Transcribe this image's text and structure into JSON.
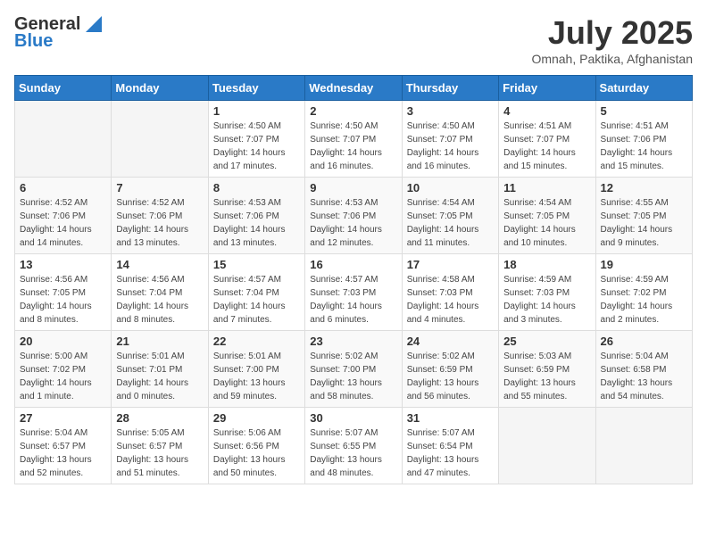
{
  "header": {
    "logo_line1": "General",
    "logo_line2": "Blue",
    "title": "July 2025",
    "subtitle": "Omnah, Paktika, Afghanistan"
  },
  "columns": [
    "Sunday",
    "Monday",
    "Tuesday",
    "Wednesday",
    "Thursday",
    "Friday",
    "Saturday"
  ],
  "weeks": [
    [
      {
        "day": "",
        "info": ""
      },
      {
        "day": "",
        "info": ""
      },
      {
        "day": "1",
        "info": "Sunrise: 4:50 AM\nSunset: 7:07 PM\nDaylight: 14 hours\nand 17 minutes."
      },
      {
        "day": "2",
        "info": "Sunrise: 4:50 AM\nSunset: 7:07 PM\nDaylight: 14 hours\nand 16 minutes."
      },
      {
        "day": "3",
        "info": "Sunrise: 4:50 AM\nSunset: 7:07 PM\nDaylight: 14 hours\nand 16 minutes."
      },
      {
        "day": "4",
        "info": "Sunrise: 4:51 AM\nSunset: 7:07 PM\nDaylight: 14 hours\nand 15 minutes."
      },
      {
        "day": "5",
        "info": "Sunrise: 4:51 AM\nSunset: 7:06 PM\nDaylight: 14 hours\nand 15 minutes."
      }
    ],
    [
      {
        "day": "6",
        "info": "Sunrise: 4:52 AM\nSunset: 7:06 PM\nDaylight: 14 hours\nand 14 minutes."
      },
      {
        "day": "7",
        "info": "Sunrise: 4:52 AM\nSunset: 7:06 PM\nDaylight: 14 hours\nand 13 minutes."
      },
      {
        "day": "8",
        "info": "Sunrise: 4:53 AM\nSunset: 7:06 PM\nDaylight: 14 hours\nand 13 minutes."
      },
      {
        "day": "9",
        "info": "Sunrise: 4:53 AM\nSunset: 7:06 PM\nDaylight: 14 hours\nand 12 minutes."
      },
      {
        "day": "10",
        "info": "Sunrise: 4:54 AM\nSunset: 7:05 PM\nDaylight: 14 hours\nand 11 minutes."
      },
      {
        "day": "11",
        "info": "Sunrise: 4:54 AM\nSunset: 7:05 PM\nDaylight: 14 hours\nand 10 minutes."
      },
      {
        "day": "12",
        "info": "Sunrise: 4:55 AM\nSunset: 7:05 PM\nDaylight: 14 hours\nand 9 minutes."
      }
    ],
    [
      {
        "day": "13",
        "info": "Sunrise: 4:56 AM\nSunset: 7:05 PM\nDaylight: 14 hours\nand 8 minutes."
      },
      {
        "day": "14",
        "info": "Sunrise: 4:56 AM\nSunset: 7:04 PM\nDaylight: 14 hours\nand 8 minutes."
      },
      {
        "day": "15",
        "info": "Sunrise: 4:57 AM\nSunset: 7:04 PM\nDaylight: 14 hours\nand 7 minutes."
      },
      {
        "day": "16",
        "info": "Sunrise: 4:57 AM\nSunset: 7:03 PM\nDaylight: 14 hours\nand 6 minutes."
      },
      {
        "day": "17",
        "info": "Sunrise: 4:58 AM\nSunset: 7:03 PM\nDaylight: 14 hours\nand 4 minutes."
      },
      {
        "day": "18",
        "info": "Sunrise: 4:59 AM\nSunset: 7:03 PM\nDaylight: 14 hours\nand 3 minutes."
      },
      {
        "day": "19",
        "info": "Sunrise: 4:59 AM\nSunset: 7:02 PM\nDaylight: 14 hours\nand 2 minutes."
      }
    ],
    [
      {
        "day": "20",
        "info": "Sunrise: 5:00 AM\nSunset: 7:02 PM\nDaylight: 14 hours\nand 1 minute."
      },
      {
        "day": "21",
        "info": "Sunrise: 5:01 AM\nSunset: 7:01 PM\nDaylight: 14 hours\nand 0 minutes."
      },
      {
        "day": "22",
        "info": "Sunrise: 5:01 AM\nSunset: 7:00 PM\nDaylight: 13 hours\nand 59 minutes."
      },
      {
        "day": "23",
        "info": "Sunrise: 5:02 AM\nSunset: 7:00 PM\nDaylight: 13 hours\nand 58 minutes."
      },
      {
        "day": "24",
        "info": "Sunrise: 5:02 AM\nSunset: 6:59 PM\nDaylight: 13 hours\nand 56 minutes."
      },
      {
        "day": "25",
        "info": "Sunrise: 5:03 AM\nSunset: 6:59 PM\nDaylight: 13 hours\nand 55 minutes."
      },
      {
        "day": "26",
        "info": "Sunrise: 5:04 AM\nSunset: 6:58 PM\nDaylight: 13 hours\nand 54 minutes."
      }
    ],
    [
      {
        "day": "27",
        "info": "Sunrise: 5:04 AM\nSunset: 6:57 PM\nDaylight: 13 hours\nand 52 minutes."
      },
      {
        "day": "28",
        "info": "Sunrise: 5:05 AM\nSunset: 6:57 PM\nDaylight: 13 hours\nand 51 minutes."
      },
      {
        "day": "29",
        "info": "Sunrise: 5:06 AM\nSunset: 6:56 PM\nDaylight: 13 hours\nand 50 minutes."
      },
      {
        "day": "30",
        "info": "Sunrise: 5:07 AM\nSunset: 6:55 PM\nDaylight: 13 hours\nand 48 minutes."
      },
      {
        "day": "31",
        "info": "Sunrise: 5:07 AM\nSunset: 6:54 PM\nDaylight: 13 hours\nand 47 minutes."
      },
      {
        "day": "",
        "info": ""
      },
      {
        "day": "",
        "info": ""
      }
    ]
  ]
}
